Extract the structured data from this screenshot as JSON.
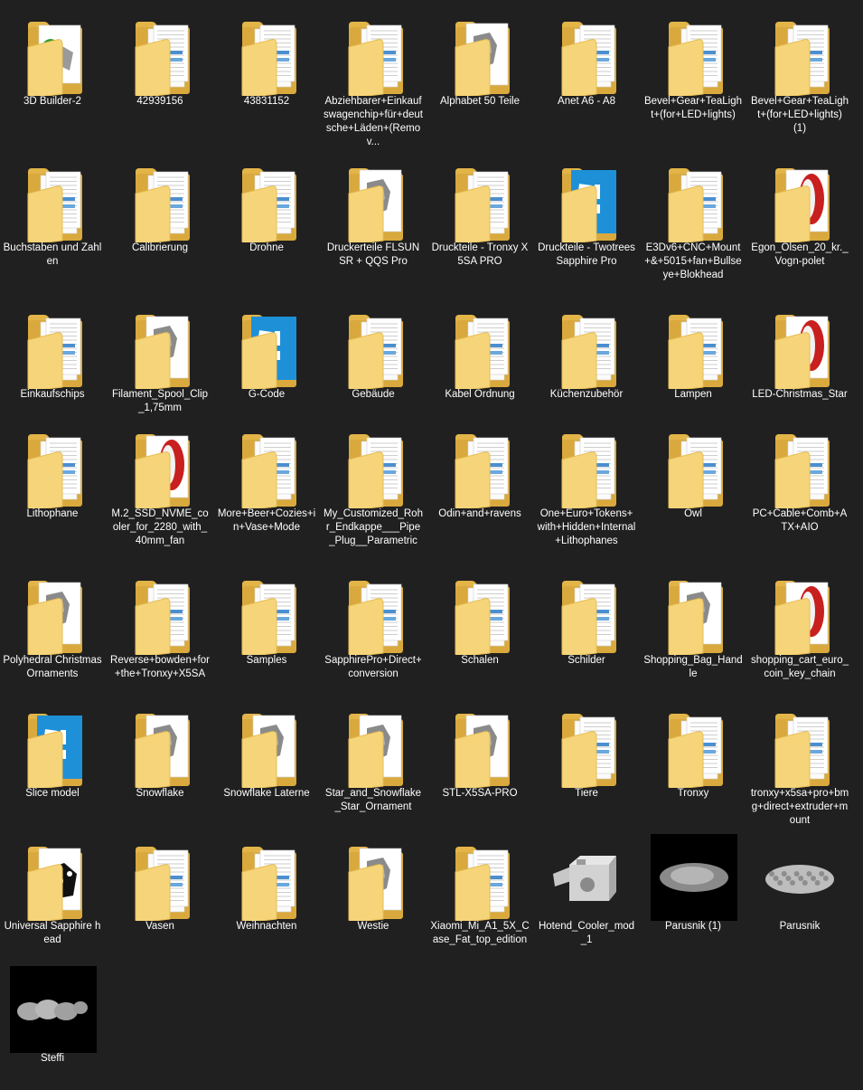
{
  "explorer": {
    "items": [
      {
        "label": "3D Builder-2",
        "icon": "folder-with-3d-builder-preview-icon",
        "preview": "builder"
      },
      {
        "label": "42939156",
        "icon": "folder-icon",
        "preview": "docs"
      },
      {
        "label": "43831152",
        "icon": "folder-icon",
        "preview": "docs"
      },
      {
        "label": "Abziehbarer+Einkaufswagenchip+für+deutsche+Läden+(Remov...",
        "icon": "folder-icon",
        "preview": "docs"
      },
      {
        "label": "Alphabet 50 Teile",
        "icon": "folder-with-model-preview-icon",
        "preview": "model"
      },
      {
        "label": "Anet A6 - A8",
        "icon": "folder-icon",
        "preview": "docs"
      },
      {
        "label": "Bevel+Gear+TeaLight+(for+LED+lights)",
        "icon": "folder-icon",
        "preview": "docs"
      },
      {
        "label": "Bevel+Gear+TeaLight+(for+LED+lights) (1)",
        "icon": "folder-icon",
        "preview": "docs"
      },
      {
        "label": "Buchstaben und Zahlen",
        "icon": "folder-icon",
        "preview": "docs"
      },
      {
        "label": "Calibrierung",
        "icon": "folder-icon",
        "preview": "docs"
      },
      {
        "label": "Drohne",
        "icon": "folder-icon",
        "preview": "docs"
      },
      {
        "label": "Druckerteile FLSUN SR + QQS Pro",
        "icon": "folder-with-model-preview-icon",
        "preview": "model"
      },
      {
        "label": "Druckteile - Tronxy X5SA PRO",
        "icon": "folder-icon",
        "preview": "docs"
      },
      {
        "label": "Druckteile - Twotrees Sapphire Pro",
        "icon": "folder-with-slicer-logo-icon",
        "preview": "slicer"
      },
      {
        "label": "E3Dv6+CNC+Mount+&+5015+fan+Bullseye+Blokhead",
        "icon": "folder-icon",
        "preview": "docs"
      },
      {
        "label": "Egon_Olsen_20_kr._Vogn-polet",
        "icon": "folder-with-red-model-preview-icon",
        "preview": "red"
      },
      {
        "label": "Einkaufschips",
        "icon": "folder-icon",
        "preview": "docs"
      },
      {
        "label": "Filament_Spool_Clip_1,75mm",
        "icon": "folder-with-model-preview-icon",
        "preview": "model"
      },
      {
        "label": "G-Code",
        "icon": "folder-with-slicer-logo-icon",
        "preview": "slicer"
      },
      {
        "label": "Gebäude",
        "icon": "folder-icon",
        "preview": "docs"
      },
      {
        "label": "Kabel Ordnung",
        "icon": "folder-icon",
        "preview": "docs"
      },
      {
        "label": "Küchenzubehör",
        "icon": "folder-icon",
        "preview": "docs"
      },
      {
        "label": "Lampen",
        "icon": "folder-icon",
        "preview": "docs"
      },
      {
        "label": "LED-Christmas_Star",
        "icon": "folder-with-red-model-preview-icon",
        "preview": "red"
      },
      {
        "label": "Lithophane",
        "icon": "folder-icon",
        "preview": "docs"
      },
      {
        "label": "M.2_SSD_NVME_cooler_for_2280_with_40mm_fan",
        "icon": "folder-with-red-model-preview-icon",
        "preview": "red"
      },
      {
        "label": "More+Beer+Cozies+in+Vase+Mode",
        "icon": "folder-icon",
        "preview": "docs"
      },
      {
        "label": "My_Customized_Rohr_Endkappe___Pipe_Plug__Parametric",
        "icon": "folder-icon",
        "preview": "docs"
      },
      {
        "label": "Odin+and+ravens",
        "icon": "folder-icon",
        "preview": "docs"
      },
      {
        "label": "One+Euro+Tokens+with+Hidden+Internal+Lithophanes",
        "icon": "folder-icon",
        "preview": "docs"
      },
      {
        "label": "Owl",
        "icon": "folder-icon",
        "preview": "docs"
      },
      {
        "label": "PC+Cable+Comb+ATX+AIO",
        "icon": "folder-icon",
        "preview": "docs"
      },
      {
        "label": "Polyhedral Christmas Ornaments",
        "icon": "folder-with-model-preview-icon",
        "preview": "model"
      },
      {
        "label": "Reverse+bowden+for+the+Tronxy+X5SA",
        "icon": "folder-icon",
        "preview": "docs"
      },
      {
        "label": "Samples",
        "icon": "folder-icon",
        "preview": "docs"
      },
      {
        "label": "SapphirePro+Direct+conversion",
        "icon": "folder-icon",
        "preview": "docs"
      },
      {
        "label": "Schalen",
        "icon": "folder-icon",
        "preview": "docs"
      },
      {
        "label": "Schilder",
        "icon": "folder-icon",
        "preview": "docs"
      },
      {
        "label": "Shopping_Bag_Handle",
        "icon": "folder-with-model-preview-icon",
        "preview": "model"
      },
      {
        "label": "shopping_cart_euro_coin_key_chain",
        "icon": "folder-with-red-model-preview-icon",
        "preview": "red"
      },
      {
        "label": "Slice model",
        "icon": "folder-with-slicer-logo-icon",
        "preview": "slicer"
      },
      {
        "label": "Snowflake",
        "icon": "folder-with-model-preview-icon",
        "preview": "model"
      },
      {
        "label": "Snowflake Laterne",
        "icon": "folder-with-model-preview-icon",
        "preview": "model"
      },
      {
        "label": "Star_and_Snowflake_Star_Ornament",
        "icon": "folder-with-model-preview-icon",
        "preview": "model"
      },
      {
        "label": "STL-X5SA-PRO",
        "icon": "folder-with-model-preview-icon",
        "preview": "model"
      },
      {
        "label": "Tiere",
        "icon": "folder-icon",
        "preview": "docs"
      },
      {
        "label": "Tronxy",
        "icon": "folder-icon",
        "preview": "docs"
      },
      {
        "label": "tronxy+x5sa+pro+bmg+direct+extruder+mount",
        "icon": "folder-icon",
        "preview": "docs"
      },
      {
        "label": "Universal Sapphire head",
        "icon": "folder-with-model-preview-icon",
        "preview": "dark"
      },
      {
        "label": "Vasen",
        "icon": "folder-icon",
        "preview": "docs"
      },
      {
        "label": "Weihnachten",
        "icon": "folder-icon",
        "preview": "docs"
      },
      {
        "label": "Westie",
        "icon": "folder-with-model-preview-icon",
        "preview": "model"
      },
      {
        "label": "Xiaomi_Mi_A1_5X_Case_Fat_top_edition",
        "icon": "folder-icon",
        "preview": "docs"
      },
      {
        "label": "Hotend_Cooler_mod_1",
        "icon": "3d-model-file-icon",
        "preview": "part"
      },
      {
        "label": "Parusnik (1)",
        "icon": "image-file-thumbnail-icon",
        "preview": "black"
      },
      {
        "label": "Parusnik",
        "icon": "3d-model-file-icon",
        "preview": "ship"
      },
      {
        "label": "Steffi",
        "icon": "image-file-thumbnail-icon",
        "preview": "black2"
      }
    ]
  }
}
